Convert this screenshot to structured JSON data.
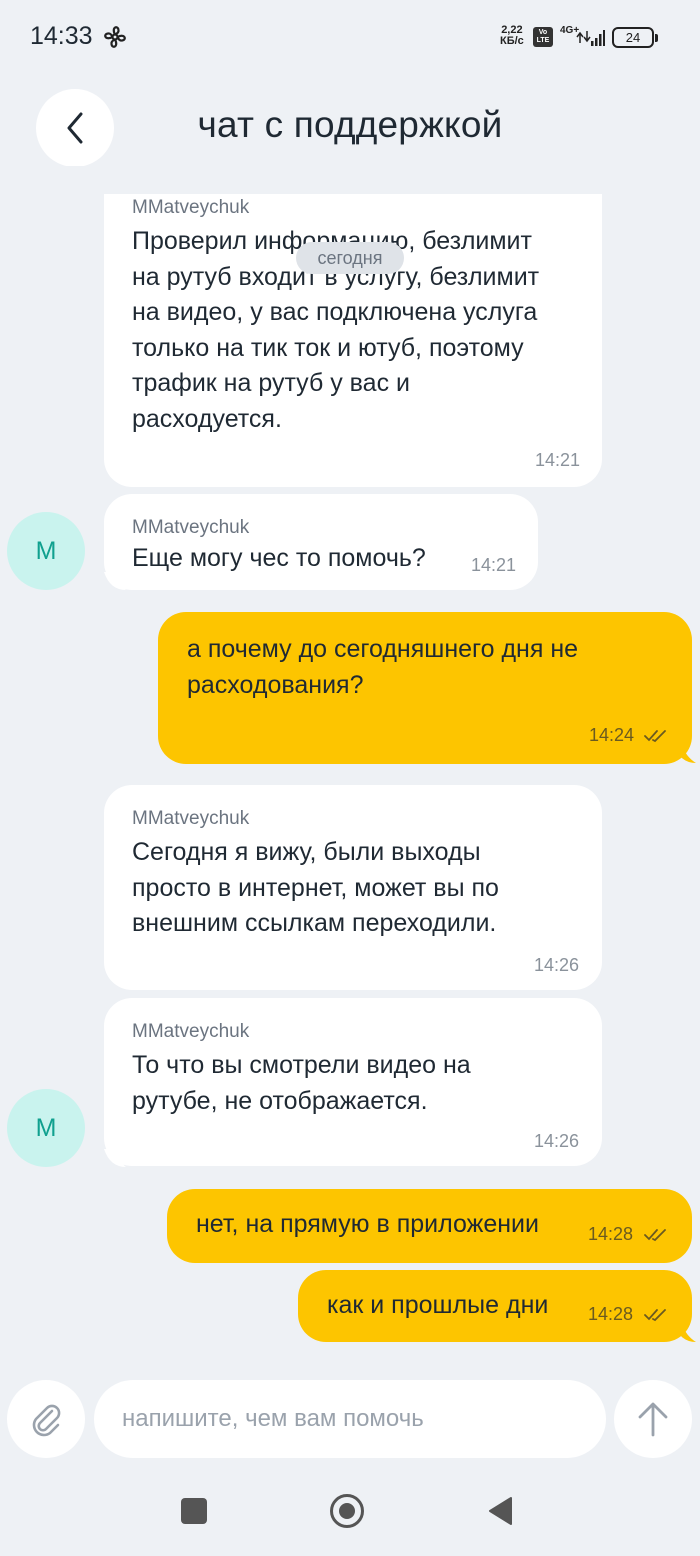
{
  "status_bar": {
    "time": "14:33",
    "net_speed_value": "2,22",
    "net_speed_unit": "КБ/с",
    "volte": "Vo LTE",
    "network": "4G+",
    "battery": "24"
  },
  "header": {
    "title": "чат с поддержкой",
    "back_icon": "chevron-left-icon"
  },
  "date_separator": "сегодня",
  "messages": [
    {
      "direction": "incoming",
      "sender": "MMatveychuk",
      "text": "Проверил информацию, безлимит\nна рутуб входит в услугу, безлимит\nна видео, у вас подключена услуга\nтолько на тик ток и ютуб, поэтому\nтрафик на рутуб у вас и\nрасходуется.",
      "time": "14:21"
    },
    {
      "direction": "incoming",
      "sender": "MMatveychuk",
      "text": "Еще могу чес то помочь?",
      "time": "14:21",
      "avatar": "M"
    },
    {
      "direction": "outgoing",
      "text": "а почему до сегодняшнего дня не\nрасходования?",
      "time": "14:24",
      "status": "read"
    },
    {
      "direction": "incoming",
      "sender": "MMatveychuk",
      "text": "Сегодня я вижу, были выходы\nпросто в интернет, может вы по\nвнешним ссылкам переходили.",
      "time": "14:26"
    },
    {
      "direction": "incoming",
      "sender": "MMatveychuk",
      "text": "То что вы смотрели видео на\nрутубе, не отображается.",
      "time": "14:26",
      "avatar": "M"
    },
    {
      "direction": "outgoing",
      "text": "нет, на прямую в приложении",
      "time": "14:28",
      "status": "read"
    },
    {
      "direction": "outgoing",
      "text": "как и прошлые дни",
      "time": "14:28",
      "status": "read"
    }
  ],
  "composer": {
    "placeholder": "напишите, чем вам помочь",
    "value": "",
    "attach_icon": "paperclip-icon",
    "send_icon": "arrow-up-icon"
  },
  "colors": {
    "background": "#eef1f5",
    "incoming_bubble": "#ffffff",
    "outgoing_bubble": "#fdc500",
    "avatar_bg": "#c9f3ee",
    "avatar_text": "#10a08f"
  }
}
